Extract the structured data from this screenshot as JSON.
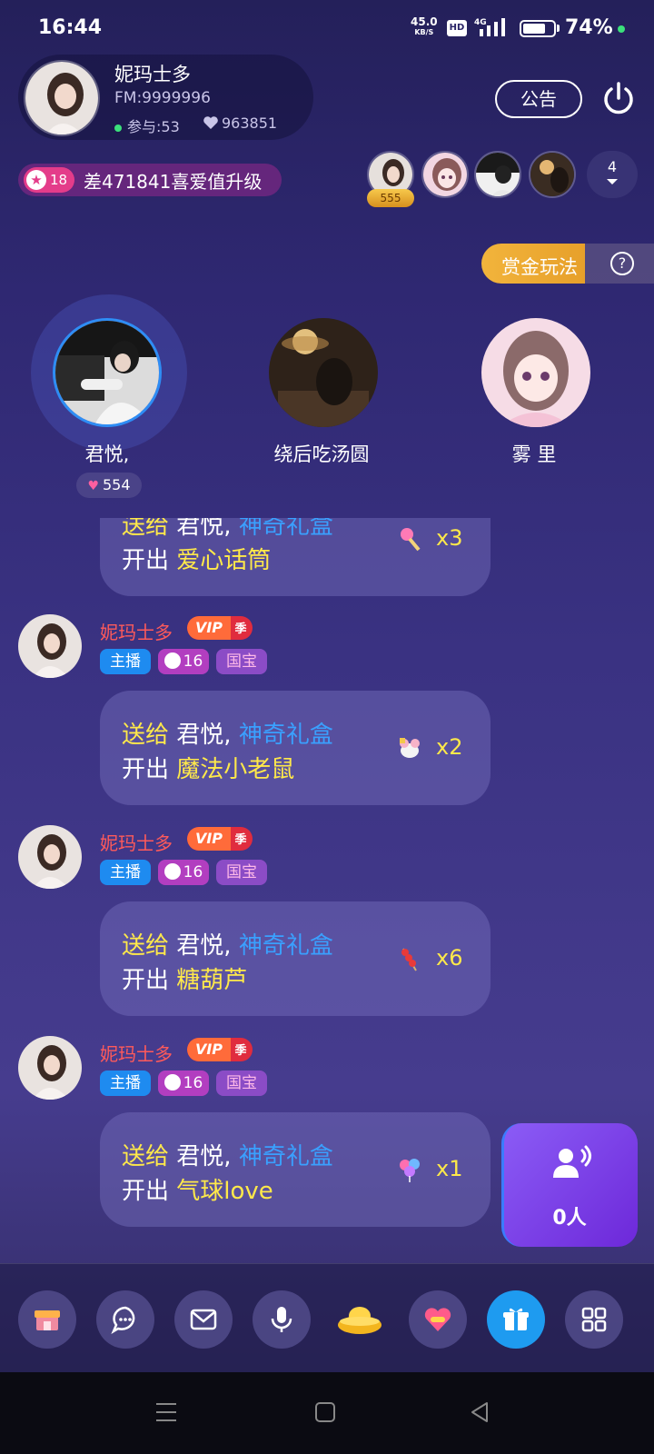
{
  "status_bar": {
    "time": "16:44",
    "net_speed": "45.0",
    "net_unit": "KB/S",
    "hd": "HD",
    "network": "4G",
    "battery_percent": "74%",
    "battery_level": 0.74
  },
  "room": {
    "name": "妮玛士多",
    "fm": "FM:9999996",
    "participants": "参与:53",
    "likes": "963851",
    "notice_label": "公告"
  },
  "level": {
    "star_level": "18",
    "upgrade_text": "差471841喜爱值升级"
  },
  "viewers": {
    "top_badge": "555",
    "count": "4"
  },
  "bounty": {
    "label": "赏金玩法",
    "help": "?"
  },
  "seats": [
    {
      "name": "君悦,",
      "hearts": "554",
      "active": true
    },
    {
      "name": "绕后吃汤圆"
    },
    {
      "name": "雾 里"
    }
  ],
  "messages": [
    {
      "partial": true,
      "send": "送给",
      "recipient": "君悦,",
      "box": "神奇礼盒",
      "open": "开出",
      "gift": "爱心话筒",
      "count": "x3"
    },
    {
      "sender": "妮玛士多",
      "vip": "VIP",
      "vip_season": "季",
      "tag_host": "主播",
      "tag_level": "16",
      "tag_rank": "国宝",
      "send": "送给",
      "recipient": "君悦,",
      "box": "神奇礼盒",
      "open": "开出",
      "gift": "魔法小老鼠",
      "count": "x2"
    },
    {
      "sender": "妮玛士多",
      "vip": "VIP",
      "vip_season": "季",
      "tag_host": "主播",
      "tag_level": "16",
      "tag_rank": "国宝",
      "send": "送给",
      "recipient": "君悦,",
      "box": "神奇礼盒",
      "open": "开出",
      "gift": "糖葫芦",
      "count": "x6"
    },
    {
      "sender": "妮玛士多",
      "vip": "VIP",
      "vip_season": "季",
      "tag_host": "主播",
      "tag_level": "16",
      "tag_rank": "国宝",
      "send": "送给",
      "recipient": "君悦,",
      "box": "神奇礼盒",
      "open": "开出",
      "gift": "气球love",
      "count": "x1"
    }
  ],
  "mic_queue": {
    "count": "0人"
  },
  "toolbar": {
    "items": [
      "shop-icon",
      "chat-icon",
      "mail-icon",
      "mic-icon",
      "gold-ingot-icon",
      "heart-box-icon",
      "gift-icon",
      "grid-icon"
    ]
  },
  "colors": {
    "accent_blue": "#1e9bf0",
    "highlight_yellow": "#ffe94a",
    "name_red": "#ff5a5a",
    "link_blue": "#3aa0ff"
  }
}
